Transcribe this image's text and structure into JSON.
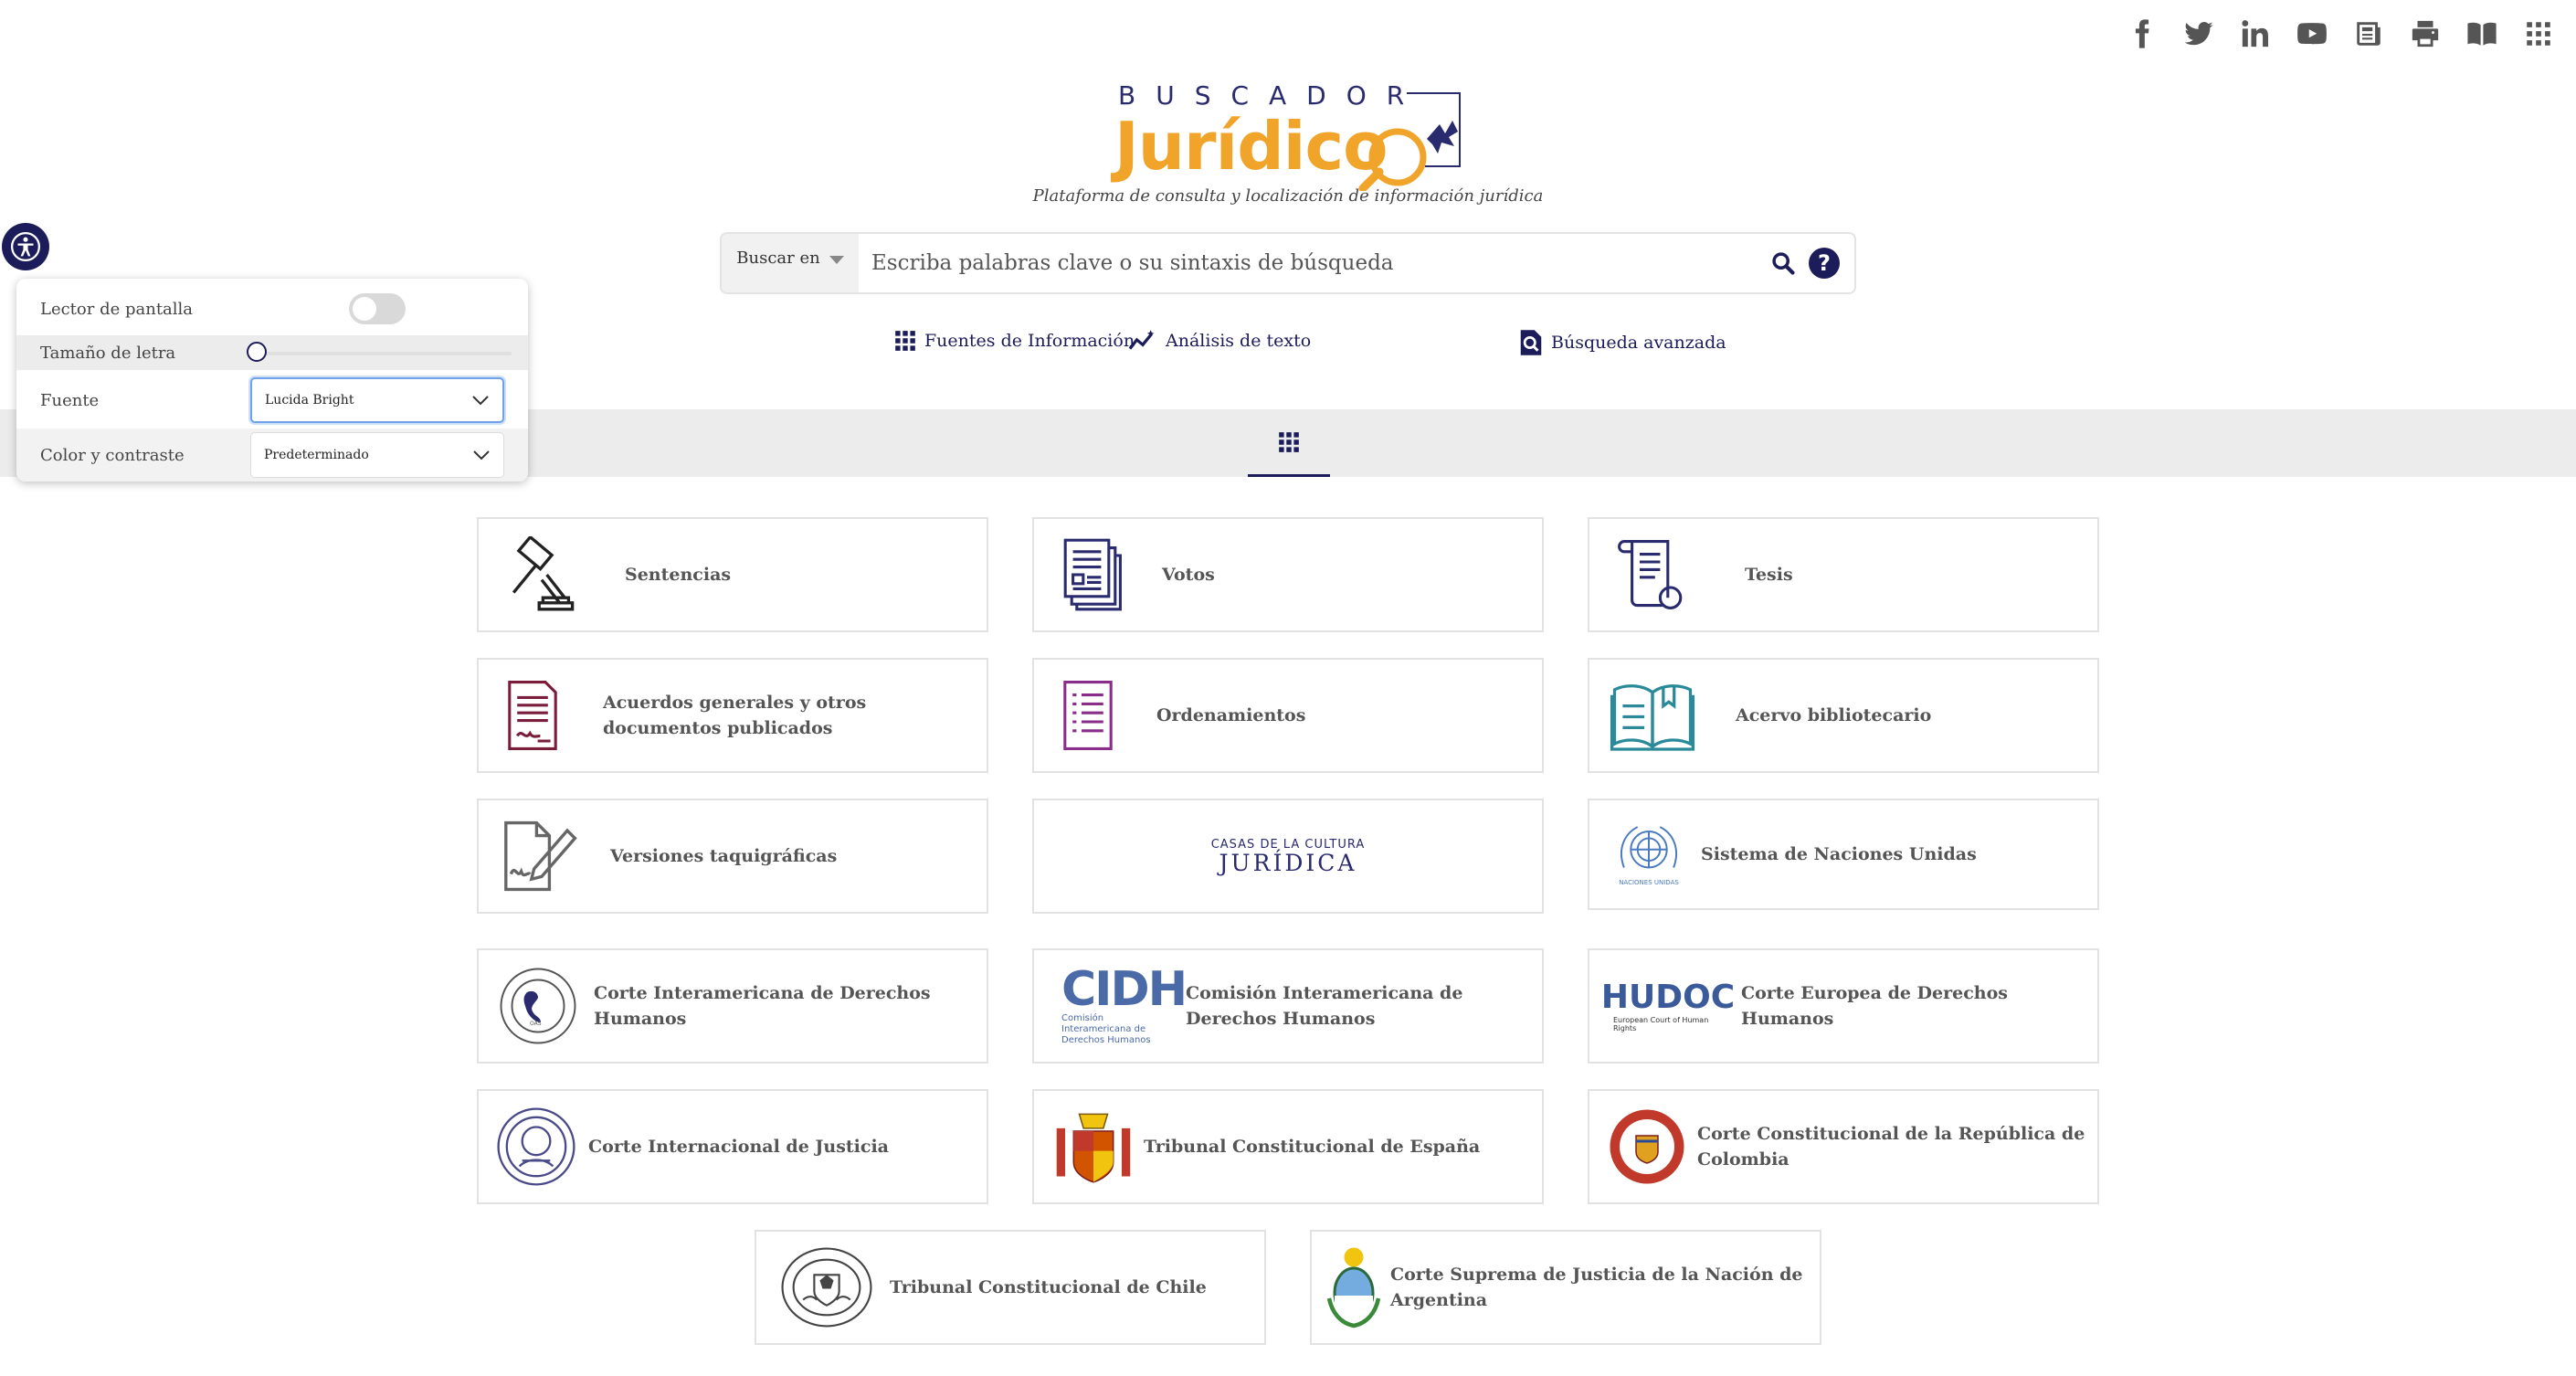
{
  "header": {
    "social": [
      {
        "icon": "facebook-icon"
      },
      {
        "icon": "twitter-icon"
      },
      {
        "icon": "linkedin-icon"
      },
      {
        "icon": "youtube-icon"
      },
      {
        "icon": "news-icon"
      },
      {
        "icon": "print-icon"
      },
      {
        "icon": "book-open-icon"
      },
      {
        "icon": "apps-grid-icon"
      }
    ],
    "logo_top": "BUSCADOR",
    "logo_main": "Jurídico",
    "tagline": "Plataforma de consulta y localización de información jurídica"
  },
  "search": {
    "scope_label": "Buscar en",
    "placeholder": "Escriba palabras clave o su sintaxis de búsqueda",
    "help_glyph": "?"
  },
  "links": {
    "sources": "Fuentes de Información",
    "text_analysis": "Análisis de texto",
    "advanced": "Búsqueda avanzada"
  },
  "accessibility": {
    "screen_reader_label": "Lector de pantalla",
    "font_size_label": "Tamaño de letra",
    "font_label": "Fuente",
    "font_value": "Lucida Bright",
    "contrast_label": "Color y contraste",
    "contrast_value": "Predeterminado"
  },
  "cards": [
    {
      "title": "Sentencias",
      "icon": "gavel-icon"
    },
    {
      "title": "Votos",
      "icon": "documents-icon"
    },
    {
      "title": "Tesis",
      "icon": "scroll-icon"
    },
    {
      "title": "Acuerdos generales y otros documentos publicados",
      "icon": "signed-document-icon"
    },
    {
      "title": "Ordenamientos",
      "icon": "list-document-icon"
    },
    {
      "title": "Acervo bibliotecario",
      "icon": "open-book-icon"
    },
    {
      "title": "Versiones taquigráficas",
      "icon": "pen-document-icon"
    },
    {
      "title": "",
      "logo_line1": "CASAS DE LA CULTURA",
      "logo_line2": "JURÍDICA",
      "icon": "casas-cultura-logo"
    },
    {
      "title": "Sistema de Naciones Unidas",
      "icon": "un-logo",
      "logo_caption": "NACIONES UNIDAS"
    },
    {
      "title": "Corte Interamericana de Derechos Humanos",
      "icon": "iachr-seal"
    },
    {
      "title": "Comisión Interamericana de Derechos Humanos",
      "icon": "cidh-logo",
      "logo_text": "CIDH",
      "logo_caption": "Comisión Interamericana de Derechos Humanos"
    },
    {
      "title": "Corte Europea de Derechos Humanos",
      "icon": "hudoc-logo",
      "logo_text": "HUDOC",
      "logo_caption": "European Court of Human Rights"
    },
    {
      "title": "Corte Internacional de Justicia",
      "icon": "icj-seal"
    },
    {
      "title": "Tribunal Constitucional de España",
      "icon": "spain-coat-of-arms"
    },
    {
      "title": "Corte Constitucional de la República de Colombia",
      "icon": "colombia-court-seal"
    },
    {
      "title": "Tribunal Constitucional de Chile",
      "icon": "chile-court-seal"
    },
    {
      "title": "Corte Suprema de Justicia de la Nación de Argentina",
      "icon": "argentina-coat-of-arms"
    }
  ]
}
